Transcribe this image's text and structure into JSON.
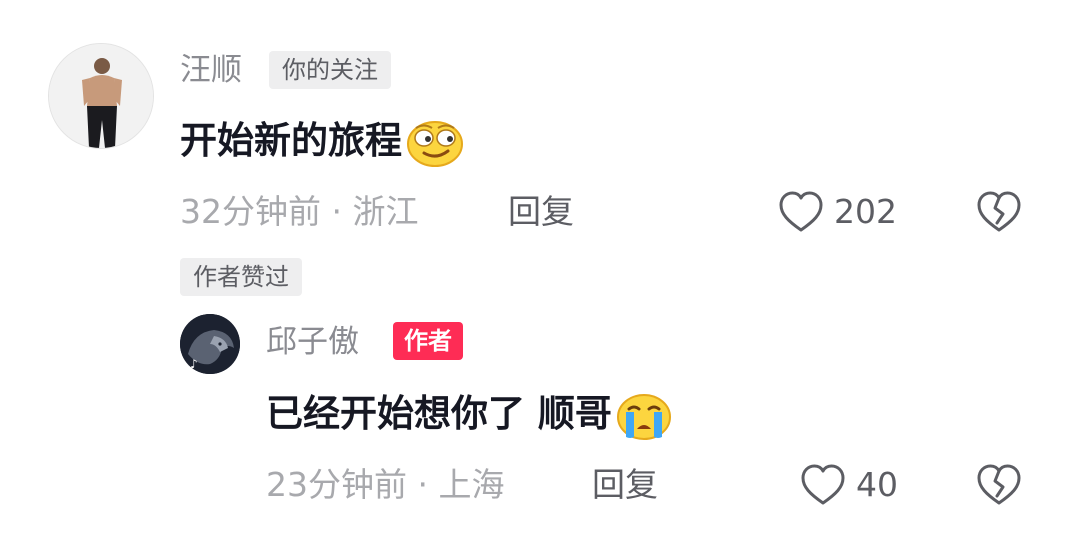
{
  "comments": [
    {
      "username": "汪顺",
      "badge": "你的关注",
      "text": "开始新的旅程",
      "emoji": "smirk-face-emoji",
      "time": "32分钟前",
      "location": "浙江",
      "reply_label": "回复",
      "likes": "202",
      "author_liked_label": "作者赞过",
      "replies": [
        {
          "username": "邱子傲",
          "badge": "作者",
          "text": "已经开始想你了 顺哥",
          "emoji": "crying-face-emoji",
          "time": "23分钟前",
          "location": "上海",
          "reply_label": "回复",
          "likes": "40"
        }
      ]
    }
  ],
  "separator": "·",
  "colors": {
    "author_badge": "#fe2c55",
    "muted_text": "#a8a9ad",
    "gray_tag_bg": "#eeeeef"
  }
}
